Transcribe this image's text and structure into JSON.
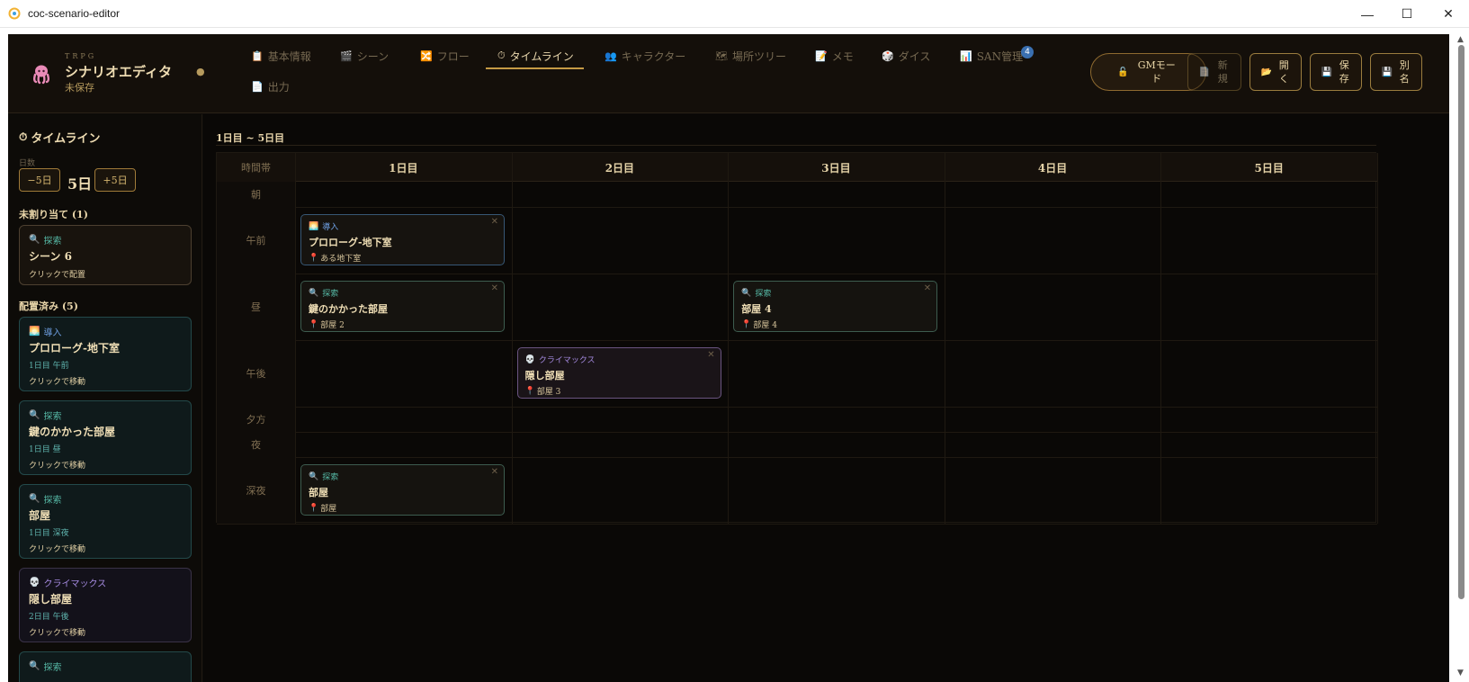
{
  "window": {
    "title": "coc-scenario-editor",
    "minimize_glyph": "—",
    "maximize_glyph": "☐",
    "close_glyph": "✕"
  },
  "header": {
    "brand_sub": "TRPG",
    "brand_title": "シナリオエディタ",
    "unsaved": "● 未保存",
    "tabs": [
      {
        "label": "基本情報",
        "icon": "clipboard-icon",
        "glyph": "📋"
      },
      {
        "label": "シーン",
        "icon": "clapper-icon",
        "glyph": "🎬"
      },
      {
        "label": "フロー",
        "icon": "shuffle-icon",
        "glyph": "🔀"
      },
      {
        "label": "タイムライン",
        "icon": "timer-icon",
        "glyph": "⏱"
      },
      {
        "label": "キャラクター",
        "icon": "people-icon",
        "glyph": "👥"
      },
      {
        "label": "場所ツリー",
        "icon": "map-icon",
        "glyph": "🗺"
      },
      {
        "label": "メモ",
        "icon": "memo-icon",
        "glyph": "📝"
      },
      {
        "label": "ダイス",
        "icon": "dice-icon",
        "glyph": "🎲"
      },
      {
        "label": "SAN管理",
        "icon": "chart-icon",
        "glyph": "📊"
      },
      {
        "label": "出力",
        "icon": "page-icon",
        "glyph": "📄"
      }
    ],
    "active_tab": "タイムライン",
    "san_badge": "4",
    "buttons": {
      "gm_mode": "GMモード",
      "new": "新規",
      "open": "開く",
      "save": "保存",
      "save_as": "別名"
    }
  },
  "sidebar": {
    "title": "タイムライン",
    "days_label": "日数",
    "minus": "−5日",
    "days_value": "5日",
    "plus": "+5日",
    "unassigned_title": "未割り当て (1)",
    "unassigned": [
      {
        "type": "探索",
        "type_icon": "magnifier-icon",
        "name": "シーン 6",
        "hint": "クリックで配置"
      }
    ],
    "placed_title": "配置済み (5)",
    "placed": [
      {
        "type": "導入",
        "type_icon": "sunrise-icon",
        "name": "プロローグ-地下室",
        "slot": "1日目 午前",
        "hint": "クリックで移動"
      },
      {
        "type": "探索",
        "type_icon": "magnifier-icon",
        "name": "鍵のかかった部屋",
        "slot": "1日目 昼",
        "hint": "クリックで移動"
      },
      {
        "type": "探索",
        "type_icon": "magnifier-icon",
        "name": "部屋",
        "slot": "1日目 深夜",
        "hint": "クリックで移動"
      },
      {
        "type": "クライマックス",
        "type_icon": "skull-icon",
        "name": "隠し部屋",
        "slot": "2日目 午後",
        "hint": "クリックで移動"
      },
      {
        "type": "探索",
        "type_icon": "magnifier-icon",
        "name": "",
        "slot": "",
        "hint": ""
      }
    ]
  },
  "timeline": {
    "range_title": "1日目 ~ 5日目",
    "corner_label": "時間帯",
    "days": [
      "1日目",
      "2日目",
      "3日目",
      "4日目",
      "5日目"
    ],
    "slots": [
      "朝",
      "午前",
      "昼",
      "午後",
      "夕方",
      "夜",
      "深夜"
    ],
    "events": [
      {
        "day": 0,
        "slot": 1,
        "kind": "intro",
        "type": "導入",
        "name": "プロローグ-地下室",
        "location": "ある地下室"
      },
      {
        "day": 0,
        "slot": 2,
        "kind": "explore",
        "type": "探索",
        "name": "鍵のかかった部屋",
        "location": "部屋 2"
      },
      {
        "day": 2,
        "slot": 2,
        "kind": "explore",
        "type": "探索",
        "name": "部屋 4",
        "location": "部屋 4"
      },
      {
        "day": 1,
        "slot": 3,
        "kind": "climax",
        "type": "クライマックス",
        "name": "隠し部屋",
        "location": "部屋 3"
      },
      {
        "day": 0,
        "slot": 6,
        "kind": "explore",
        "type": "探索",
        "name": "部屋",
        "location": "部屋"
      }
    ],
    "remove_glyph": "✕"
  },
  "colors": {
    "explore": "#56b9a6",
    "intro": "#6d9ee0",
    "climax": "#a58ae0",
    "accent": "#c59a45"
  }
}
